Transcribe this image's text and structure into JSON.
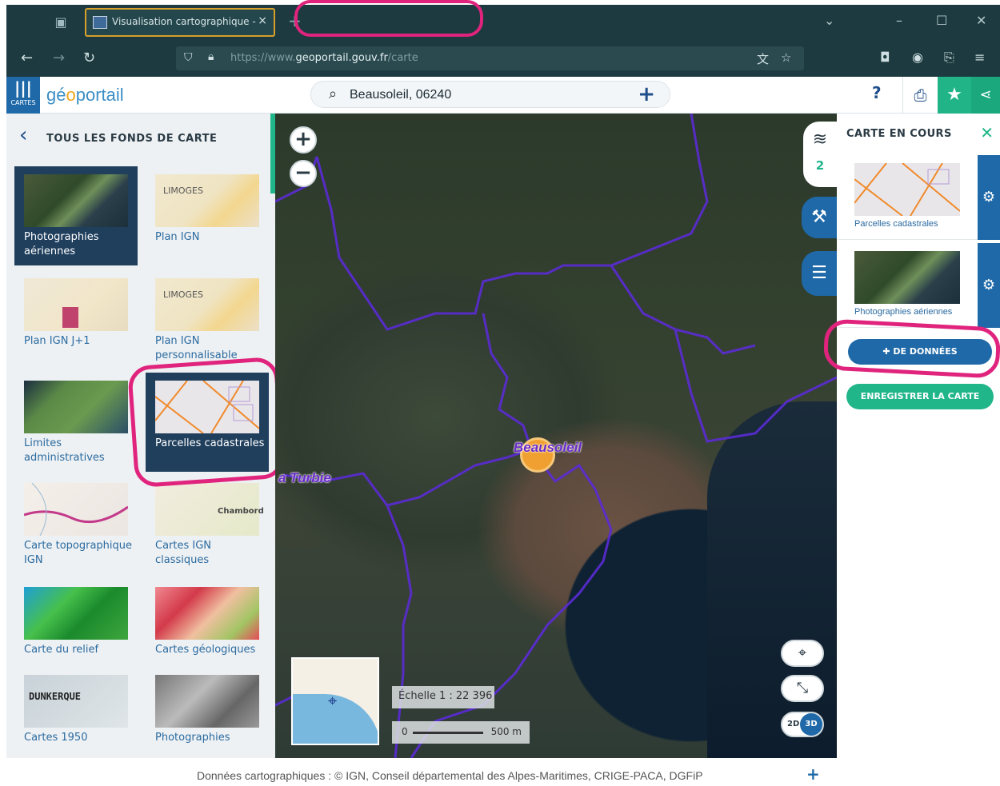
{
  "browser": {
    "tab_title": "Visualisation cartographique -",
    "tab_close": "×",
    "new_tab": "+",
    "url_prefix": "https://www.",
    "url_domain": "geoportail.gouv.fr",
    "url_path": "/carte",
    "controls": {
      "minimize": "–",
      "maximize": "☐",
      "close": "✕",
      "dropdown": "⌄"
    }
  },
  "header": {
    "cartes_label": "CARTES",
    "logo_part1": "gé",
    "logo_part2": "o",
    "logo_part3": "portail",
    "search_value": "Beausoleil, 06240",
    "help": "?"
  },
  "left_panel": {
    "title": "TOUS LES FONDS DE CARTE",
    "tiles": [
      {
        "label": "Photographies aériennes",
        "selected": true
      },
      {
        "label": "Plan IGN",
        "selected": false
      },
      {
        "label": "Plan IGN J+1",
        "selected": false
      },
      {
        "label": "Plan IGN personnalisable",
        "selected": false
      },
      {
        "label": "Limites administratives",
        "selected": false
      },
      {
        "label": "Parcelles cadastrales",
        "selected": true
      },
      {
        "label": "Carte topographique IGN",
        "selected": false
      },
      {
        "label": "Cartes IGN classiques",
        "selected": false
      },
      {
        "label": "Carte du relief",
        "selected": false
      },
      {
        "label": "Cartes géologiques",
        "selected": false
      },
      {
        "label": "Cartes 1950",
        "selected": false
      },
      {
        "label": "Photographies",
        "selected": false
      }
    ],
    "thumb_text": {
      "limoges": "LIMOGES",
      "dunkerque": "DUNKERQUE",
      "chambord": "Chambord"
    }
  },
  "map": {
    "place_labels": {
      "beausoleil": "Beausoleil",
      "turbie": "a Turbie"
    },
    "scale_text": "Échelle 1 : 22 396",
    "scale_zero": "0",
    "scale_distance": "500 m",
    "toggle_2d": "2D",
    "toggle_3d": "3D"
  },
  "side_tabs": {
    "layers_count": "2"
  },
  "right_panel": {
    "title": "CARTE EN COURS",
    "layers": [
      {
        "name": "Parcelles cadastrales"
      },
      {
        "name": "Photographies aériennes"
      }
    ],
    "add_data_label": "DE DONNÉES",
    "save_map_label": "ENREGISTRER LA CARTE"
  },
  "footer": {
    "attribution": "Données cartographiques : ©   IGN,  Conseil départemental des Alpes-Maritimes,  CRIGE-PACA,  DGFiP"
  },
  "colors": {
    "brand_blue": "#1f69a8",
    "brand_green": "#21b58a",
    "highlight_pink": "#e0247d",
    "boundary_purple": "#6a2cc9"
  }
}
